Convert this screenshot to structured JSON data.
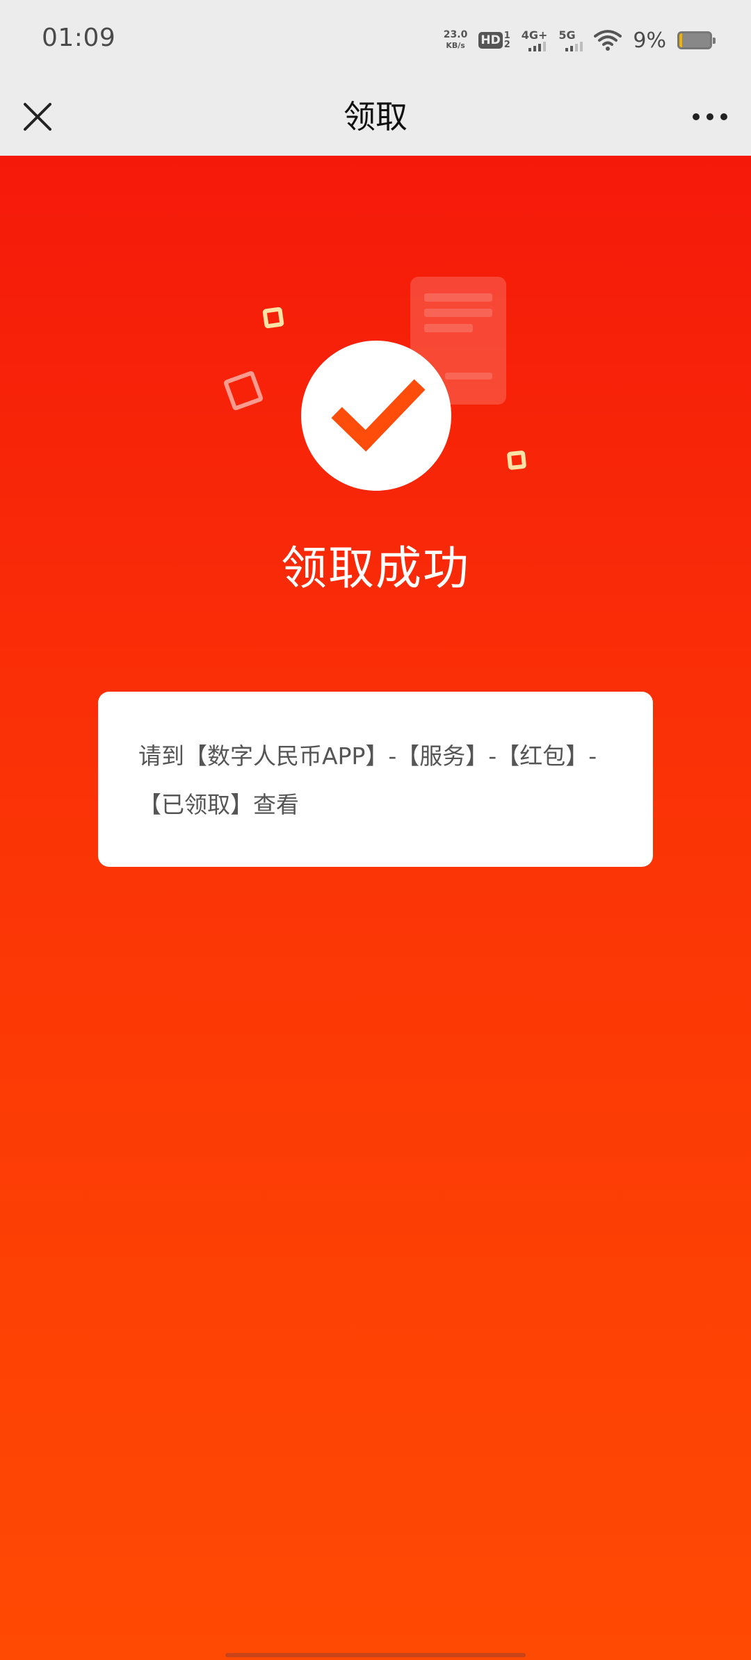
{
  "status_bar": {
    "time": "01:09",
    "net_speed_value": "23.0",
    "net_speed_unit": "KB/s",
    "hd_label": "HD",
    "hd_sim_top": "1",
    "hd_sim_bottom": "2",
    "signal_1_label": "4G+",
    "signal_2_label": "5G",
    "battery_percent": "9%",
    "battery_level": 0.09,
    "icons": [
      "wifi-icon",
      "battery-icon"
    ]
  },
  "header": {
    "title": "领取",
    "close_icon": "close-icon",
    "more_icon": "more-dots-icon"
  },
  "main": {
    "success_title": "领取成功",
    "info_text": "请到【数字人民币APP】-【服务】-【红包】-【已领取】查看",
    "icons": [
      "check-circle-icon",
      "document-icon",
      "square-sparkle-icon"
    ]
  },
  "colors": {
    "background_top": "#f5190a",
    "background_bottom": "#ff4a03",
    "check_color": "#fe4d0b",
    "header_bg": "#ececec"
  }
}
